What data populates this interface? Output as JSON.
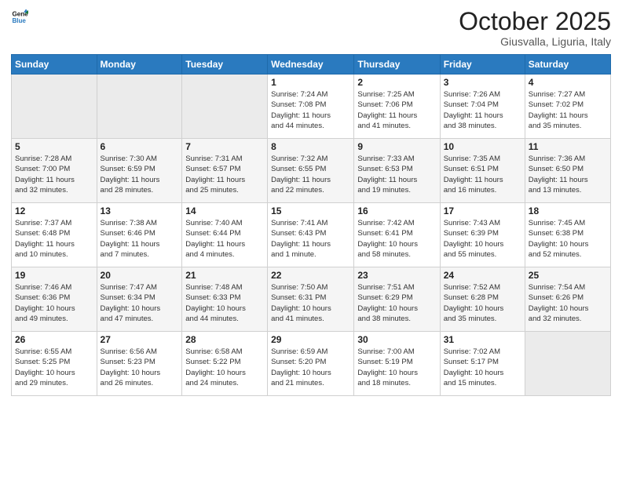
{
  "header": {
    "logo_line1": "General",
    "logo_line2": "Blue",
    "month_title": "October 2025",
    "location": "Giusvalla, Liguria, Italy"
  },
  "weekdays": [
    "Sunday",
    "Monday",
    "Tuesday",
    "Wednesday",
    "Thursday",
    "Friday",
    "Saturday"
  ],
  "weeks": [
    [
      {
        "day": "",
        "info": ""
      },
      {
        "day": "",
        "info": ""
      },
      {
        "day": "",
        "info": ""
      },
      {
        "day": "1",
        "info": "Sunrise: 7:24 AM\nSunset: 7:08 PM\nDaylight: 11 hours\nand 44 minutes."
      },
      {
        "day": "2",
        "info": "Sunrise: 7:25 AM\nSunset: 7:06 PM\nDaylight: 11 hours\nand 41 minutes."
      },
      {
        "day": "3",
        "info": "Sunrise: 7:26 AM\nSunset: 7:04 PM\nDaylight: 11 hours\nand 38 minutes."
      },
      {
        "day": "4",
        "info": "Sunrise: 7:27 AM\nSunset: 7:02 PM\nDaylight: 11 hours\nand 35 minutes."
      }
    ],
    [
      {
        "day": "5",
        "info": "Sunrise: 7:28 AM\nSunset: 7:00 PM\nDaylight: 11 hours\nand 32 minutes."
      },
      {
        "day": "6",
        "info": "Sunrise: 7:30 AM\nSunset: 6:59 PM\nDaylight: 11 hours\nand 28 minutes."
      },
      {
        "day": "7",
        "info": "Sunrise: 7:31 AM\nSunset: 6:57 PM\nDaylight: 11 hours\nand 25 minutes."
      },
      {
        "day": "8",
        "info": "Sunrise: 7:32 AM\nSunset: 6:55 PM\nDaylight: 11 hours\nand 22 minutes."
      },
      {
        "day": "9",
        "info": "Sunrise: 7:33 AM\nSunset: 6:53 PM\nDaylight: 11 hours\nand 19 minutes."
      },
      {
        "day": "10",
        "info": "Sunrise: 7:35 AM\nSunset: 6:51 PM\nDaylight: 11 hours\nand 16 minutes."
      },
      {
        "day": "11",
        "info": "Sunrise: 7:36 AM\nSunset: 6:50 PM\nDaylight: 11 hours\nand 13 minutes."
      }
    ],
    [
      {
        "day": "12",
        "info": "Sunrise: 7:37 AM\nSunset: 6:48 PM\nDaylight: 11 hours\nand 10 minutes."
      },
      {
        "day": "13",
        "info": "Sunrise: 7:38 AM\nSunset: 6:46 PM\nDaylight: 11 hours\nand 7 minutes."
      },
      {
        "day": "14",
        "info": "Sunrise: 7:40 AM\nSunset: 6:44 PM\nDaylight: 11 hours\nand 4 minutes."
      },
      {
        "day": "15",
        "info": "Sunrise: 7:41 AM\nSunset: 6:43 PM\nDaylight: 11 hours\nand 1 minute."
      },
      {
        "day": "16",
        "info": "Sunrise: 7:42 AM\nSunset: 6:41 PM\nDaylight: 10 hours\nand 58 minutes."
      },
      {
        "day": "17",
        "info": "Sunrise: 7:43 AM\nSunset: 6:39 PM\nDaylight: 10 hours\nand 55 minutes."
      },
      {
        "day": "18",
        "info": "Sunrise: 7:45 AM\nSunset: 6:38 PM\nDaylight: 10 hours\nand 52 minutes."
      }
    ],
    [
      {
        "day": "19",
        "info": "Sunrise: 7:46 AM\nSunset: 6:36 PM\nDaylight: 10 hours\nand 49 minutes."
      },
      {
        "day": "20",
        "info": "Sunrise: 7:47 AM\nSunset: 6:34 PM\nDaylight: 10 hours\nand 47 minutes."
      },
      {
        "day": "21",
        "info": "Sunrise: 7:48 AM\nSunset: 6:33 PM\nDaylight: 10 hours\nand 44 minutes."
      },
      {
        "day": "22",
        "info": "Sunrise: 7:50 AM\nSunset: 6:31 PM\nDaylight: 10 hours\nand 41 minutes."
      },
      {
        "day": "23",
        "info": "Sunrise: 7:51 AM\nSunset: 6:29 PM\nDaylight: 10 hours\nand 38 minutes."
      },
      {
        "day": "24",
        "info": "Sunrise: 7:52 AM\nSunset: 6:28 PM\nDaylight: 10 hours\nand 35 minutes."
      },
      {
        "day": "25",
        "info": "Sunrise: 7:54 AM\nSunset: 6:26 PM\nDaylight: 10 hours\nand 32 minutes."
      }
    ],
    [
      {
        "day": "26",
        "info": "Sunrise: 6:55 AM\nSunset: 5:25 PM\nDaylight: 10 hours\nand 29 minutes."
      },
      {
        "day": "27",
        "info": "Sunrise: 6:56 AM\nSunset: 5:23 PM\nDaylight: 10 hours\nand 26 minutes."
      },
      {
        "day": "28",
        "info": "Sunrise: 6:58 AM\nSunset: 5:22 PM\nDaylight: 10 hours\nand 24 minutes."
      },
      {
        "day": "29",
        "info": "Sunrise: 6:59 AM\nSunset: 5:20 PM\nDaylight: 10 hours\nand 21 minutes."
      },
      {
        "day": "30",
        "info": "Sunrise: 7:00 AM\nSunset: 5:19 PM\nDaylight: 10 hours\nand 18 minutes."
      },
      {
        "day": "31",
        "info": "Sunrise: 7:02 AM\nSunset: 5:17 PM\nDaylight: 10 hours\nand 15 minutes."
      },
      {
        "day": "",
        "info": ""
      }
    ]
  ]
}
